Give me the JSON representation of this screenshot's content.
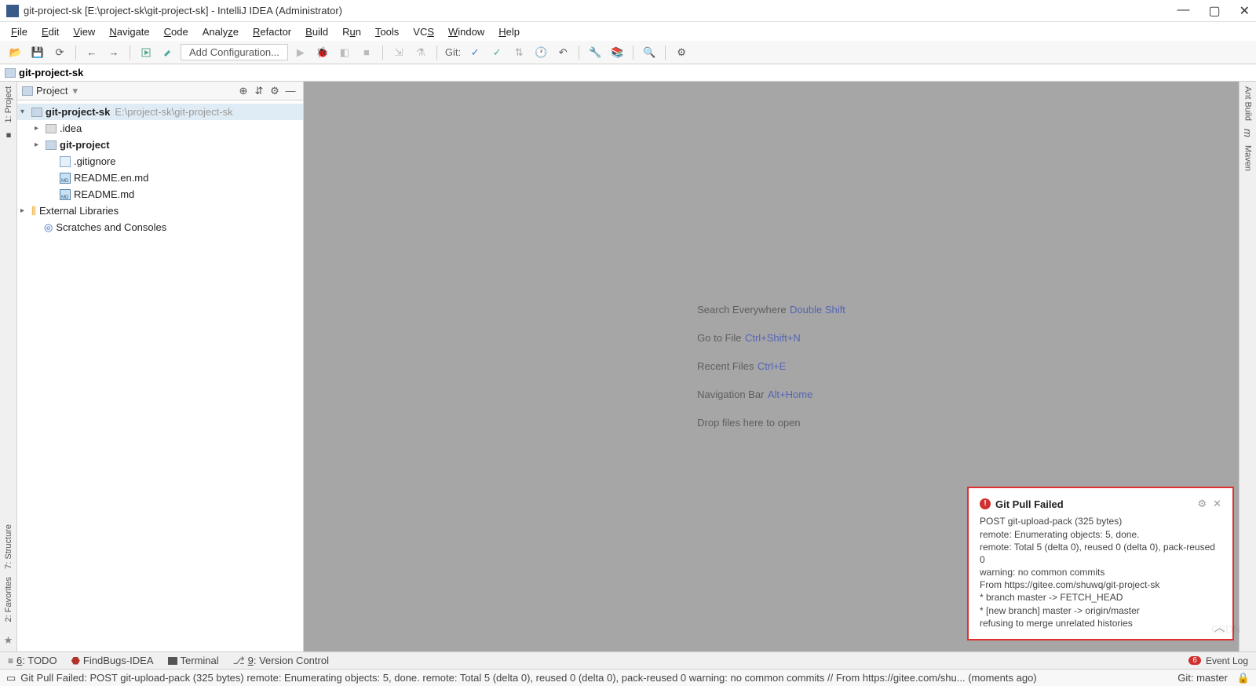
{
  "title_bar": {
    "text": "git-project-sk [E:\\project-sk\\git-project-sk] - IntelliJ IDEA (Administrator)"
  },
  "menu": [
    "File",
    "Edit",
    "View",
    "Navigate",
    "Code",
    "Analyze",
    "Refactor",
    "Build",
    "Run",
    "Tools",
    "VCS",
    "Window",
    "Help"
  ],
  "toolbar": {
    "config_label": "Add Configuration...",
    "git_label": "Git:"
  },
  "breadcrumb": {
    "root": "git-project-sk"
  },
  "project_panel": {
    "title": "Project",
    "tree": {
      "root_name": "git-project-sk",
      "root_path": "E:\\project-sk\\git-project-sk",
      "idea": ".idea",
      "module": "git-project",
      "gitignore": ".gitignore",
      "readme_en": "README.en.md",
      "readme": "README.md",
      "ext_libs": "External Libraries",
      "scratches": "Scratches and Consoles"
    }
  },
  "side_tabs_left": {
    "project": "1: Project",
    "structure": "7: Structure",
    "favorites": "2: Favorites"
  },
  "side_tabs_right": {
    "ant": "Ant Build",
    "maven": "Maven"
  },
  "editor_hints": {
    "search": "Search Everywhere",
    "search_sc": "Double Shift",
    "goto": "Go to File",
    "goto_sc": "Ctrl+Shift+N",
    "recent": "Recent Files",
    "recent_sc": "Ctrl+E",
    "navbar": "Navigation Bar",
    "navbar_sc": "Alt+Home",
    "drop": "Drop files here to open"
  },
  "notification": {
    "title": "Git Pull Failed",
    "body": "POST git-upload-pack (325 bytes)\nremote: Enumerating objects: 5, done.\nremote: Total 5 (delta 0), reused 0 (delta 0), pack-reused 0\nwarning: no common commits\nFrom https://gitee.com/shuwq/git-project-sk\n* branch master -> FETCH_HEAD\n* [new branch] master -> origin/master\nrefusing to merge unrelated histories"
  },
  "bottom_tabs": {
    "todo": "6: TODO",
    "findbugs": "FindBugs-IDEA",
    "terminal": "Terminal",
    "vcs": "9: Version Control",
    "event_badge": "6",
    "event_log": "Event Log"
  },
  "status_bar": {
    "message": "Git Pull Failed: POST git-upload-pack (325 bytes) remote: Enumerating objects: 5, done. remote: Total 5 (delta 0), reused 0 (delta 0), pack-reused 0 warning: no common commits // From https://gitee.com/shu... (moments ago)",
    "branch": "Git: master"
  }
}
